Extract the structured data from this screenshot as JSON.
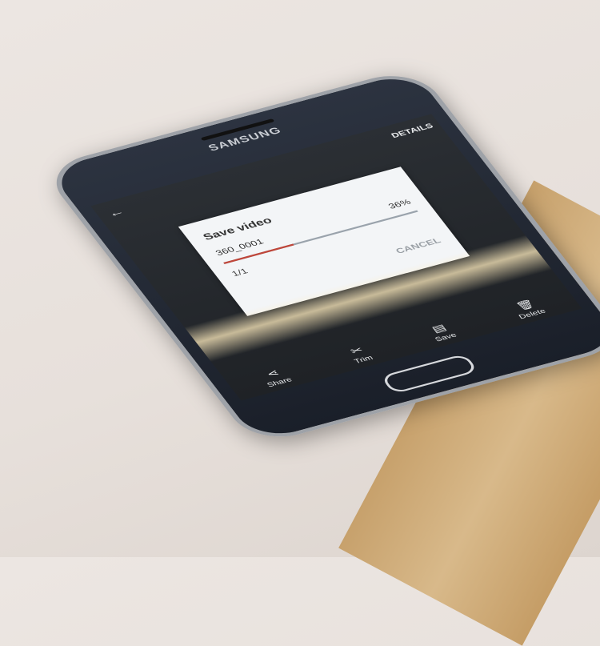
{
  "phone": {
    "brand": "SAMSUNG",
    "header_action": "DETAILS"
  },
  "dialog": {
    "title": "Save video",
    "file_name": "360_0001",
    "progress_percent": "36%",
    "progress_value": 36,
    "count": "1/1",
    "cancel_label": "CANCEL"
  },
  "toolbar": {
    "items": [
      {
        "label": "Share",
        "icon": "share-icon"
      },
      {
        "label": "Trim",
        "icon": "scissors-icon"
      },
      {
        "label": "Save",
        "icon": "save-icon"
      },
      {
        "label": "Delete",
        "icon": "trash-icon"
      }
    ]
  },
  "colors": {
    "progress_fill": "#c0463a",
    "dialog_bg": "#f3f5f7"
  }
}
